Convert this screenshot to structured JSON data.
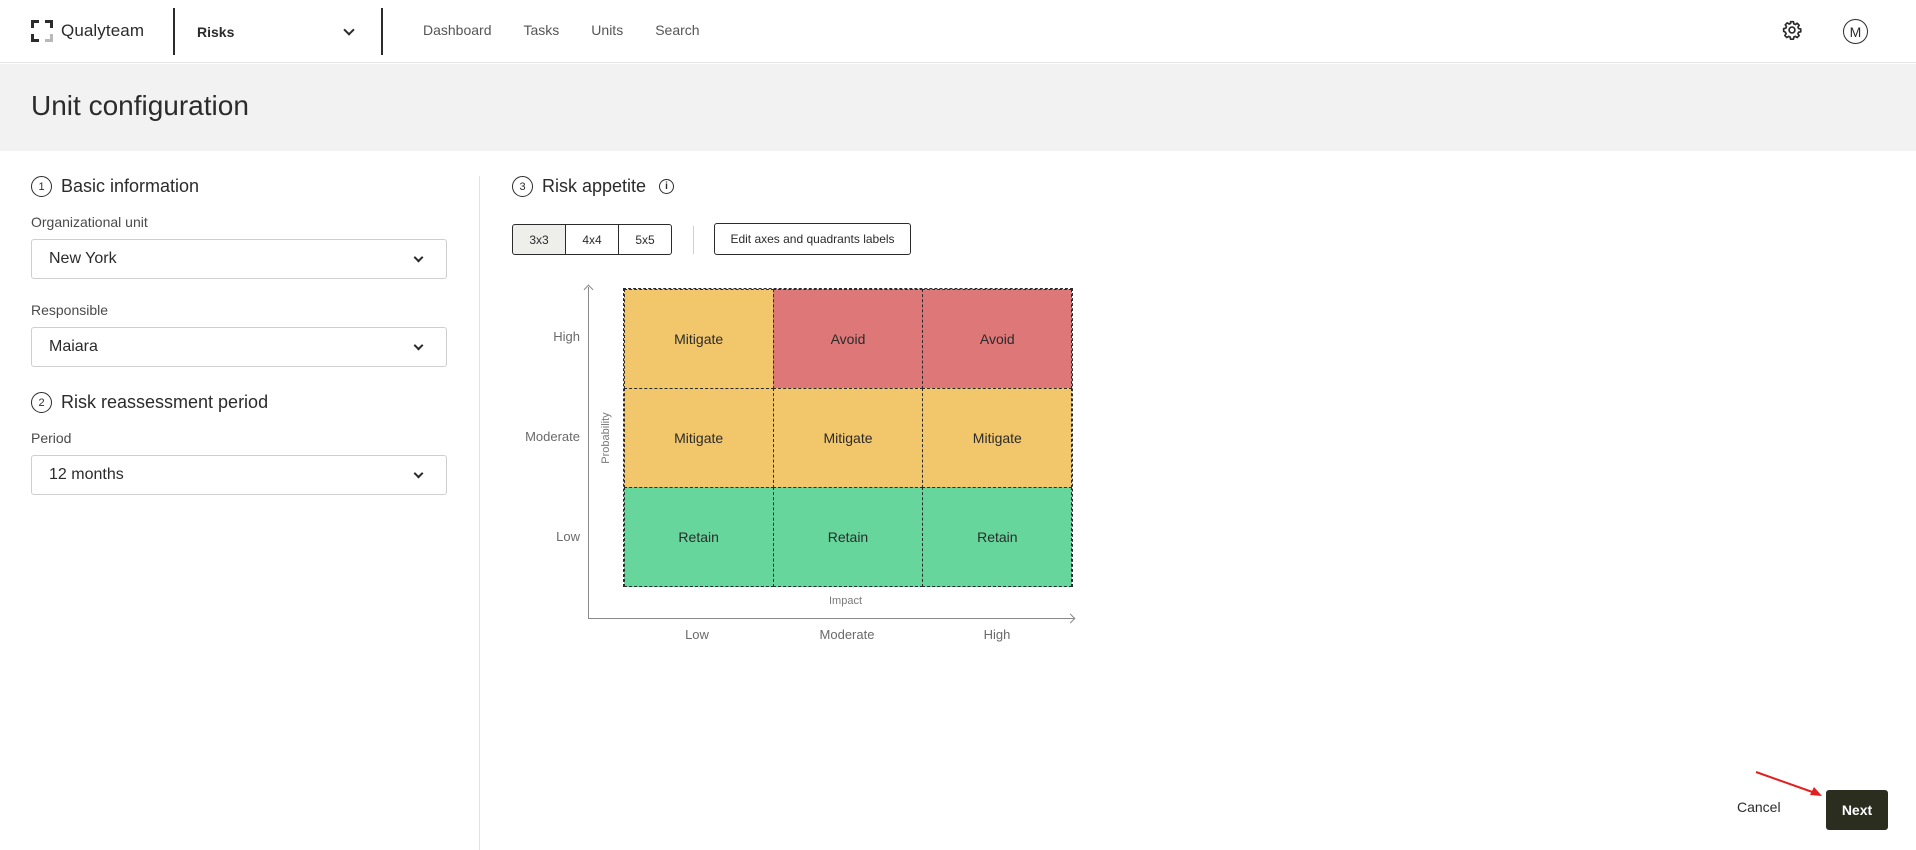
{
  "topbar": {
    "brand": "Qualyteam",
    "module": "Risks",
    "nav": [
      "Dashboard",
      "Tasks",
      "Units",
      "Search"
    ],
    "avatar_initial": "M",
    "icons": [
      "settings-gear-icon",
      "chevron-down-icon"
    ]
  },
  "page": {
    "title": "Unit configuration"
  },
  "basic_info": {
    "number": "1",
    "title": "Basic information",
    "org_unit_label": "Organizational unit",
    "org_unit_value": "New York",
    "responsible_label": "Responsible",
    "responsible_value": "Maiara"
  },
  "reassessment": {
    "number": "2",
    "title": "Risk reassessment period",
    "period_label": "Period",
    "period_value": "12 months"
  },
  "risk_appetite": {
    "number": "3",
    "title": "Risk appetite",
    "info_glyph": "i",
    "sizes": [
      "3x3",
      "4x4",
      "5x5"
    ],
    "selected_size": "3x3",
    "edit_button": "Edit axes and quadrants labels",
    "y_axis_title": "Probability",
    "x_axis_title": "Impact",
    "y_labels": [
      "High",
      "Moderate",
      "Low"
    ],
    "x_labels": [
      "Low",
      "Moderate",
      "High"
    ],
    "cells": [
      [
        "Mitigate",
        "Avoid",
        "Avoid"
      ],
      [
        "Mitigate",
        "Mitigate",
        "Mitigate"
      ],
      [
        "Retain",
        "Retain",
        "Retain"
      ]
    ],
    "colors": {
      "Mitigate": "#f2c66b",
      "Avoid": "#de7777",
      "Retain": "#67d69c"
    }
  },
  "footer": {
    "cancel": "Cancel",
    "next": "Next"
  }
}
